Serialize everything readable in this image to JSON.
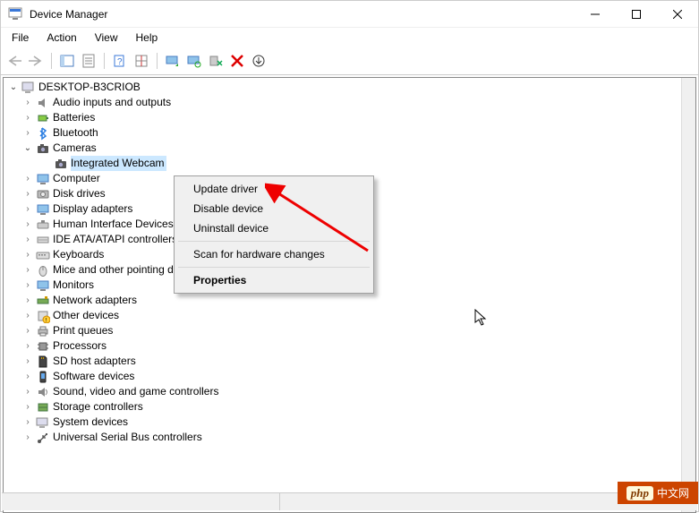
{
  "window": {
    "title": "Device Manager"
  },
  "menu": {
    "file": "File",
    "action": "Action",
    "view": "View",
    "help": "Help"
  },
  "tree": {
    "root": "DESKTOP-B3CRIOB",
    "cat": {
      "audio": "Audio inputs and outputs",
      "batteries": "Batteries",
      "bluetooth": "Bluetooth",
      "cameras": "Cameras",
      "cameras_child": "Integrated Webcam",
      "computer": "Computer",
      "disk": "Disk drives",
      "display": "Display adapters",
      "hid": "Human Interface Devices",
      "ide": "IDE ATA/ATAPI controllers",
      "keyboards": "Keyboards",
      "mice": "Mice and other pointing devices",
      "monitors": "Monitors",
      "network": "Network adapters",
      "other": "Other devices",
      "printq": "Print queues",
      "processors": "Processors",
      "sdhost": "SD host adapters",
      "software": "Software devices",
      "sound": "Sound, video and game controllers",
      "storage": "Storage controllers",
      "system": "System devices",
      "usb": "Universal Serial Bus controllers"
    }
  },
  "context_menu": {
    "update": "Update driver",
    "disable": "Disable device",
    "uninstall": "Uninstall device",
    "scan": "Scan for hardware changes",
    "properties": "Properties"
  },
  "watermark": {
    "prefix": "php",
    "text": "中文网"
  }
}
